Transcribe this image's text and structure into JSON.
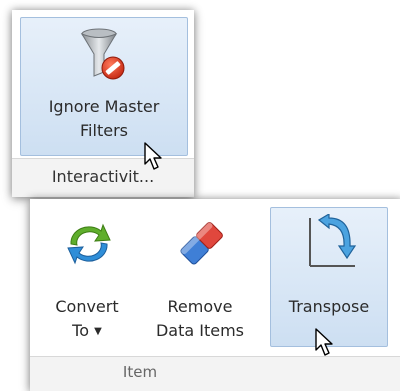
{
  "top_panel": {
    "button_label_line1": "Ignore Master",
    "button_label_line2": "Filters",
    "group_label": "Interactivit..."
  },
  "bottom_panel": {
    "convert": {
      "line1": "Convert",
      "line2": "To",
      "dropdown_glyph": "▼"
    },
    "remove": {
      "line1": "Remove",
      "line2": "Data Items"
    },
    "transpose": {
      "label": "Transpose"
    },
    "group_label": "Item"
  },
  "icons": {
    "ignore_master_filters": "funnel-no-entry-icon",
    "convert_to": "circular-arrows-icon",
    "remove_data_items": "eraser-icon",
    "transpose": "transpose-arrow-icon",
    "pointer": "mouse-pointer-icon"
  },
  "colors": {
    "highlight_fill": "#d6e5f5",
    "highlight_border": "#a4bfde",
    "group_bar": "#f3f3f3",
    "no_entry_red": "#d9381e"
  }
}
